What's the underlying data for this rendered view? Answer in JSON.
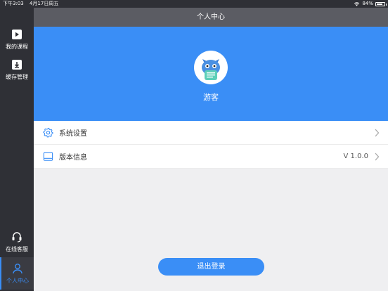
{
  "status_bar": {
    "time": "下午3:03",
    "date": "4月17日周五",
    "battery": "84%",
    "battery_level": 0.84
  },
  "header": {
    "title": "个人中心"
  },
  "sidebar": {
    "items": [
      {
        "label": "我的课程",
        "icon": "play-icon"
      },
      {
        "label": "缓存管理",
        "icon": "download-icon"
      },
      {
        "label": "在线客服",
        "icon": "headset-icon"
      },
      {
        "label": "个人中心",
        "icon": "user-icon",
        "active": true
      }
    ]
  },
  "profile": {
    "name": "游客",
    "avatar_icon": "cartoon-avatar"
  },
  "menu": [
    {
      "label": "系统设置",
      "icon": "gear-icon",
      "value": ""
    },
    {
      "label": "版本信息",
      "icon": "tablet-icon",
      "value": "V 1.0.0"
    }
  ],
  "logout_label": "退出登录",
  "colors": {
    "accent": "#3a8ef6",
    "sidebar": "#2f3036",
    "topbar": "#5b5c63",
    "background": "#efeff1"
  }
}
